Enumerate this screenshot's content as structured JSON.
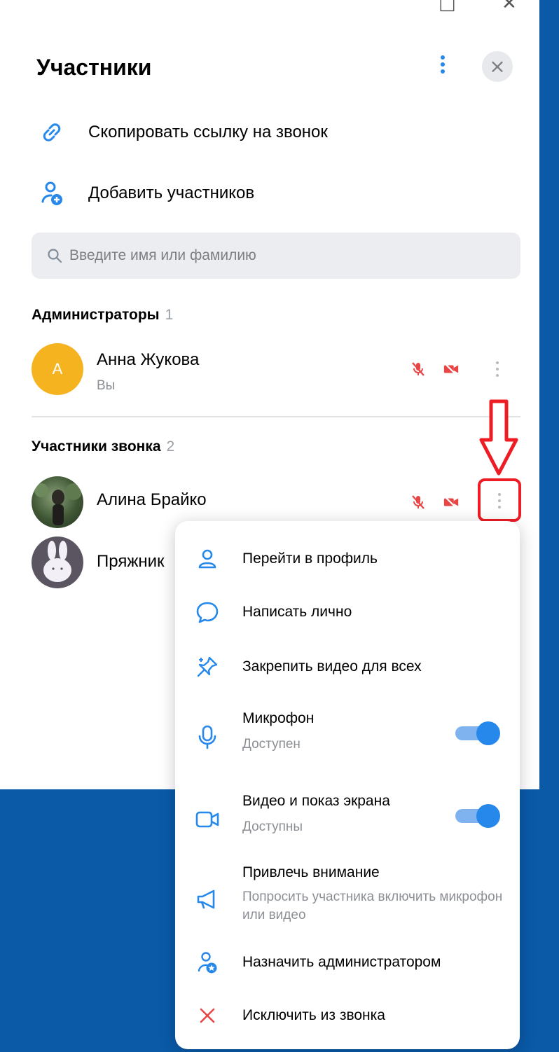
{
  "window": {
    "maximize_glyph": "□",
    "close_glyph": "✕"
  },
  "panel": {
    "title": "Участники",
    "actions": [
      {
        "label": "Скопировать ссылку на звонок",
        "icon": "link-icon"
      },
      {
        "label": "Добавить участников",
        "icon": "add-user-icon"
      }
    ],
    "search": {
      "placeholder": "Введите имя или фамилию"
    },
    "sections": {
      "admins": {
        "title": "Администраторы",
        "count": "1"
      },
      "participants": {
        "title": "Участники звонка",
        "count": "2"
      }
    },
    "admins": [
      {
        "name": "Анна Жукова",
        "subtitle": "Вы",
        "initial": "А",
        "avatar_color": "#f5b320"
      }
    ],
    "participants": [
      {
        "name": "Алина Брайко"
      },
      {
        "name": "Пряжник"
      }
    ]
  },
  "context_menu": {
    "items": [
      {
        "label": "Перейти в профиль",
        "icon": "profile-icon"
      },
      {
        "label": "Написать лично",
        "icon": "message-icon"
      },
      {
        "label": "Закрепить видео для всех",
        "icon": "pin-icon"
      },
      {
        "label": "Микрофон",
        "sub": "Доступен",
        "icon": "microphone-icon",
        "toggle": true
      },
      {
        "label": "Видео и показ экрана",
        "sub": "Доступны",
        "icon": "camera-icon",
        "toggle": true
      },
      {
        "label": "Привлечь внимание",
        "sub": "Попросить участника включить микрофон или видео",
        "icon": "megaphone-icon"
      },
      {
        "label": "Назначить администратором",
        "icon": "admin-icon"
      },
      {
        "label": "Исключить из звонка",
        "icon": "remove-icon"
      }
    ]
  },
  "colors": {
    "accent": "#2688eb",
    "danger": "#e64646",
    "annotation": "#ee1c24",
    "background_blue": "#0a5aa8"
  }
}
